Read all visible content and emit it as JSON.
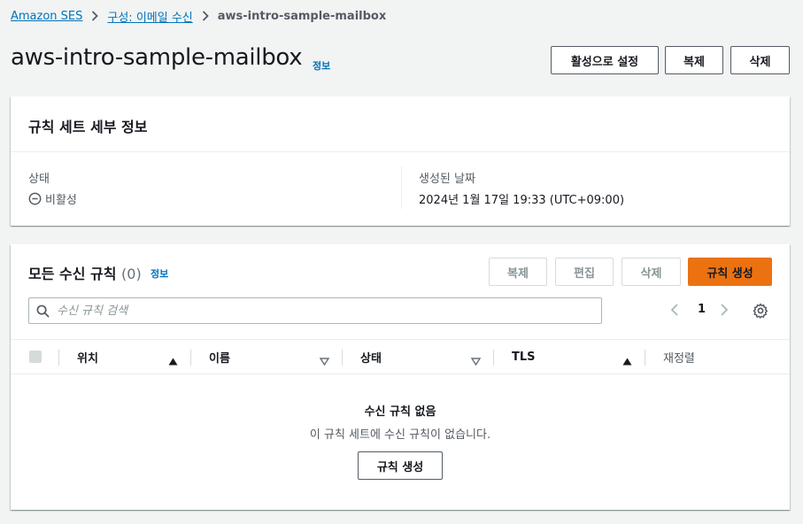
{
  "breadcrumb": {
    "items": [
      {
        "label": "Amazon SES"
      },
      {
        "label": "구성: 이메일 수신"
      }
    ],
    "current": "aws-intro-sample-mailbox"
  },
  "header": {
    "title": "aws-intro-sample-mailbox",
    "info": "정보",
    "buttons": {
      "activate": "활성으로 설정",
      "duplicate": "복제",
      "delete": "삭제"
    }
  },
  "details": {
    "title": "규칙 세트 세부 정보",
    "status_label": "상태",
    "status_value": "비활성",
    "created_label": "생성된 날짜",
    "created_value": "2024년 1월 17일 19:33 (UTC+09:00)"
  },
  "rules": {
    "title": "모든 수신 규칙",
    "count": "(0)",
    "info": "정보",
    "actions": {
      "duplicate": "복제",
      "edit": "편집",
      "delete": "삭제",
      "create": "규칙 생성"
    },
    "search_placeholder": "수신 규칙 검색",
    "page": "1",
    "columns": [
      "위치",
      "이름",
      "상태",
      "TLS",
      "재정렬"
    ],
    "empty_title": "수신 규칙 없음",
    "empty_desc": "이 규칙 세트에 수신 규칙이 없습니다.",
    "empty_button": "규칙 생성"
  },
  "colors": {
    "link": "#0073bb",
    "primary": "#ec7211",
    "background": "#f2f3f3"
  }
}
